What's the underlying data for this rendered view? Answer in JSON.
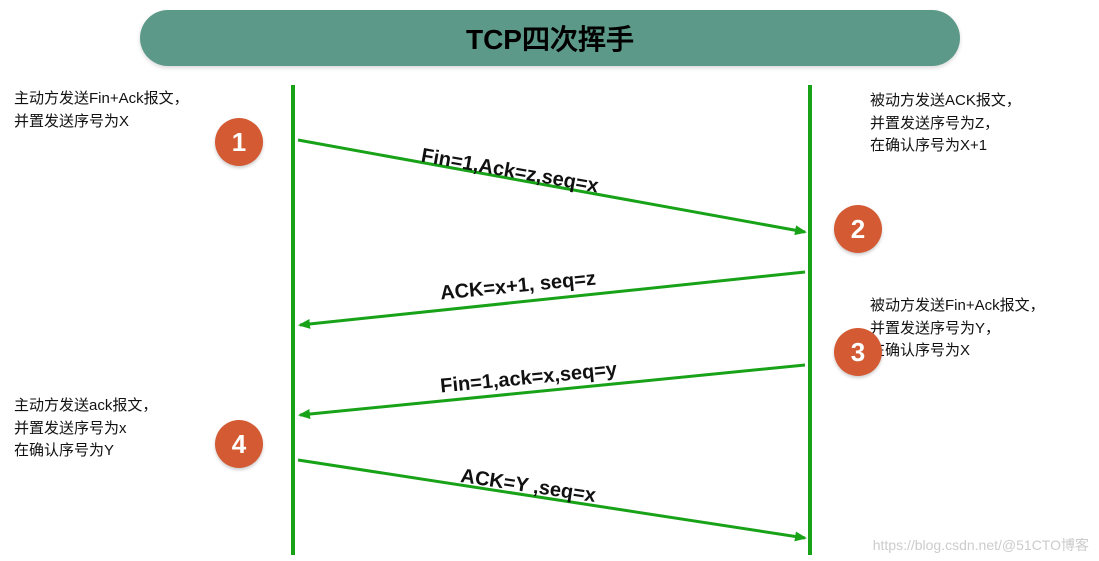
{
  "header": {
    "title": "TCP四次挥手"
  },
  "descriptions": {
    "d1": "主动方发送Fin+Ack报文，\n并置发送序号为X",
    "d2": "被动方发送ACK报文，\n并置发送序号为Z，\n在确认序号为X+1",
    "d3": "被动方发送Fin+Ack报文，\n并置发送序号为Y，\n在确认序号为X",
    "d4": "主动方发送ack报文，\n并置发送序号为x\n在确认序号为Y"
  },
  "badges": {
    "b1": "1",
    "b2": "2",
    "b3": "3",
    "b4": "4"
  },
  "messages": {
    "m1": "Fin=1,Ack=z,seq=x",
    "m2": "ACK=x+1, seq=z",
    "m3": "Fin=1,ack=x,seq=y",
    "m4": "ACK=Y ,seq=x"
  },
  "watermark": "https://blog.csdn.net/@51CTO博客"
}
